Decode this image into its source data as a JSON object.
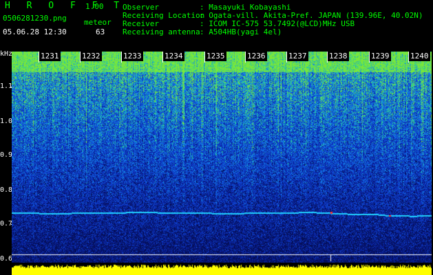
{
  "app": {
    "title": "H R O F F T",
    "version": "1.00",
    "filename": "0506281230.png",
    "mode": "meteor",
    "datetime": "05.06.28 12:30",
    "count": "63"
  },
  "info": [
    {
      "label": "Observer",
      "value": ": Masayuki Kobayashi"
    },
    {
      "label": "Receiving Location",
      "value": ": Ogata-vill. Akita-Pref. JAPAN (139.96E, 40.02N)"
    },
    {
      "label": "Receiver",
      "value": ": ICOM IC-575 53.7492(@LCD)MHz USB"
    },
    {
      "label": "Receiving antenna",
      "value": ": A504HB(yagi 4el)"
    }
  ],
  "axis": {
    "unit": "kHz",
    "y_ticks": [
      "1.1",
      "1.0",
      "0.9",
      "0.8",
      "0.7",
      "0.6"
    ],
    "time_labels": [
      "1231",
      "1232",
      "1233",
      "1234",
      "1235",
      "1236",
      "1237",
      "1238",
      "1239",
      "1240"
    ]
  },
  "colors": {
    "background": "#000000",
    "header_green": "#00ff00",
    "spectrum_base": "#0a1aa0",
    "spectrum_mid": "#1060ff",
    "spectrum_high": "#30d0a0",
    "echo_trace": "#20d0ff",
    "baseline": "#ffff00"
  }
}
